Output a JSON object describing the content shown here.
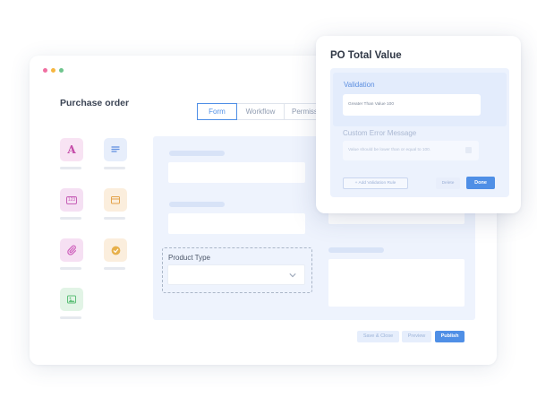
{
  "window": {
    "title": "Purchase order",
    "tabs": [
      {
        "label": "Form",
        "active": true
      },
      {
        "label": "Workflow",
        "active": false
      },
      {
        "label": "Permissions",
        "active": false
      }
    ]
  },
  "palette": [
    {
      "icon": "text-field-icon",
      "glyph": "A",
      "bg": "#f8e3f3",
      "fg": "#c54ba8"
    },
    {
      "icon": "paragraph-icon",
      "bg": "#e7eefb",
      "fg": "#5f8fe0"
    },
    {
      "icon": "number-field-icon",
      "glyph": "123",
      "bg": "#f5e0f3",
      "fg": "#c760b7"
    },
    {
      "icon": "calendar-icon",
      "bg": "#fbeedd",
      "fg": "#e3a34a"
    },
    {
      "icon": "attachment-icon",
      "bg": "#f6e0f3",
      "fg": "#cf62bd"
    },
    {
      "icon": "checkmark-icon",
      "bg": "#fbeedd",
      "fg": "#e7b04b"
    },
    {
      "icon": "image-icon",
      "bg": "#e2f4e6",
      "fg": "#5dbf78"
    }
  ],
  "form": {
    "product_type_label": "Product Type"
  },
  "footer": {
    "save_close": "Save & Close",
    "preview": "Preview",
    "publish": "Publish"
  },
  "panel": {
    "title": "PO Total Value",
    "validation_label": "Validation",
    "validation_value": "Greater Than Value 100",
    "custom_error_label": "Custom Error Message",
    "custom_error_value": "Value should be lower than or equal to 100.",
    "add_rules": "+ Add Validation Rule",
    "delete": "Delete",
    "done": "Done"
  },
  "colors": {
    "accent": "#4f8fe6"
  }
}
